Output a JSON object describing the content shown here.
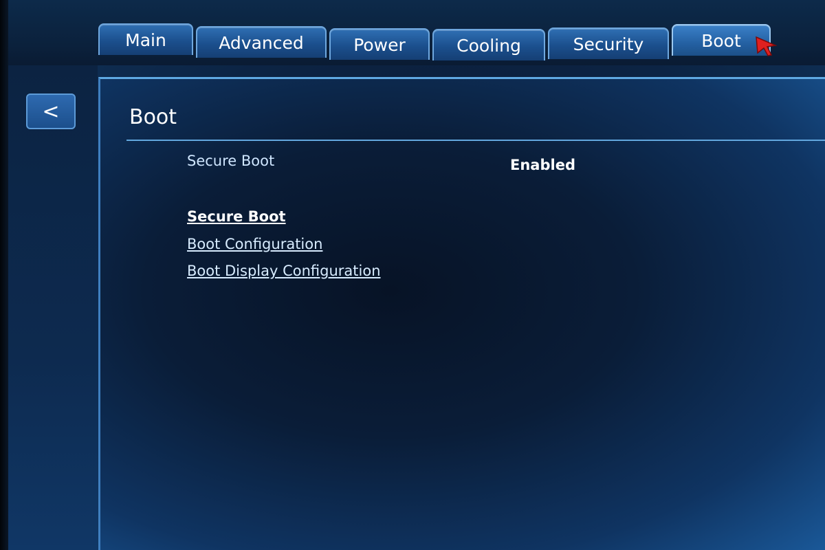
{
  "tabs": [
    {
      "label": "Main",
      "active": false
    },
    {
      "label": "Advanced",
      "active": false
    },
    {
      "label": "Power",
      "active": false
    },
    {
      "label": "Cooling",
      "active": false
    },
    {
      "label": "Security",
      "active": false
    },
    {
      "label": "Boot",
      "active": true
    }
  ],
  "back_button": {
    "label": "<"
  },
  "panel": {
    "title": "Boot",
    "settings": [
      {
        "label": "Secure Boot",
        "value": "Enabled"
      }
    ],
    "links": [
      {
        "label": "Secure Boot",
        "selected": true
      },
      {
        "label": "Boot Configuration",
        "selected": false
      },
      {
        "label": "Boot Display Configuration",
        "selected": false
      }
    ]
  },
  "colors": {
    "tab_border": "#6fa8df",
    "tab_fill": "#1b4f8d",
    "panel_rule": "#63a8df",
    "cursor": "#e02020"
  },
  "icons": {
    "cursor": "mouse-pointer-icon"
  }
}
